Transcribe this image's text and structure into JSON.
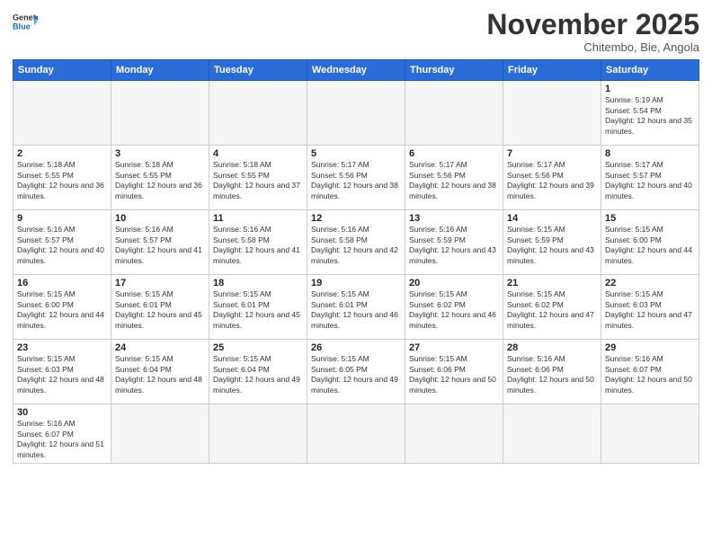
{
  "logo": {
    "text_general": "General",
    "text_blue": "Blue"
  },
  "header": {
    "month": "November 2025",
    "location": "Chitembo, Bie, Angola"
  },
  "days_of_week": [
    "Sunday",
    "Monday",
    "Tuesday",
    "Wednesday",
    "Thursday",
    "Friday",
    "Saturday"
  ],
  "weeks": [
    [
      {
        "num": "",
        "info": ""
      },
      {
        "num": "",
        "info": ""
      },
      {
        "num": "",
        "info": ""
      },
      {
        "num": "",
        "info": ""
      },
      {
        "num": "",
        "info": ""
      },
      {
        "num": "",
        "info": ""
      },
      {
        "num": "1",
        "info": "Sunrise: 5:19 AM\nSunset: 5:54 PM\nDaylight: 12 hours and 35 minutes."
      }
    ],
    [
      {
        "num": "2",
        "info": "Sunrise: 5:18 AM\nSunset: 5:55 PM\nDaylight: 12 hours and 36 minutes."
      },
      {
        "num": "3",
        "info": "Sunrise: 5:18 AM\nSunset: 5:55 PM\nDaylight: 12 hours and 36 minutes."
      },
      {
        "num": "4",
        "info": "Sunrise: 5:18 AM\nSunset: 5:55 PM\nDaylight: 12 hours and 37 minutes."
      },
      {
        "num": "5",
        "info": "Sunrise: 5:17 AM\nSunset: 5:56 PM\nDaylight: 12 hours and 38 minutes."
      },
      {
        "num": "6",
        "info": "Sunrise: 5:17 AM\nSunset: 5:56 PM\nDaylight: 12 hours and 38 minutes."
      },
      {
        "num": "7",
        "info": "Sunrise: 5:17 AM\nSunset: 5:56 PM\nDaylight: 12 hours and 39 minutes."
      },
      {
        "num": "8",
        "info": "Sunrise: 5:17 AM\nSunset: 5:57 PM\nDaylight: 12 hours and 40 minutes."
      }
    ],
    [
      {
        "num": "9",
        "info": "Sunrise: 5:16 AM\nSunset: 5:57 PM\nDaylight: 12 hours and 40 minutes."
      },
      {
        "num": "10",
        "info": "Sunrise: 5:16 AM\nSunset: 5:57 PM\nDaylight: 12 hours and 41 minutes."
      },
      {
        "num": "11",
        "info": "Sunrise: 5:16 AM\nSunset: 5:58 PM\nDaylight: 12 hours and 41 minutes."
      },
      {
        "num": "12",
        "info": "Sunrise: 5:16 AM\nSunset: 5:58 PM\nDaylight: 12 hours and 42 minutes."
      },
      {
        "num": "13",
        "info": "Sunrise: 5:16 AM\nSunset: 5:59 PM\nDaylight: 12 hours and 43 minutes."
      },
      {
        "num": "14",
        "info": "Sunrise: 5:15 AM\nSunset: 5:59 PM\nDaylight: 12 hours and 43 minutes."
      },
      {
        "num": "15",
        "info": "Sunrise: 5:15 AM\nSunset: 6:00 PM\nDaylight: 12 hours and 44 minutes."
      }
    ],
    [
      {
        "num": "16",
        "info": "Sunrise: 5:15 AM\nSunset: 6:00 PM\nDaylight: 12 hours and 44 minutes."
      },
      {
        "num": "17",
        "info": "Sunrise: 5:15 AM\nSunset: 6:01 PM\nDaylight: 12 hours and 45 minutes."
      },
      {
        "num": "18",
        "info": "Sunrise: 5:15 AM\nSunset: 6:01 PM\nDaylight: 12 hours and 45 minutes."
      },
      {
        "num": "19",
        "info": "Sunrise: 5:15 AM\nSunset: 6:01 PM\nDaylight: 12 hours and 46 minutes."
      },
      {
        "num": "20",
        "info": "Sunrise: 5:15 AM\nSunset: 6:02 PM\nDaylight: 12 hours and 46 minutes."
      },
      {
        "num": "21",
        "info": "Sunrise: 5:15 AM\nSunset: 6:02 PM\nDaylight: 12 hours and 47 minutes."
      },
      {
        "num": "22",
        "info": "Sunrise: 5:15 AM\nSunset: 6:03 PM\nDaylight: 12 hours and 47 minutes."
      }
    ],
    [
      {
        "num": "23",
        "info": "Sunrise: 5:15 AM\nSunset: 6:03 PM\nDaylight: 12 hours and 48 minutes."
      },
      {
        "num": "24",
        "info": "Sunrise: 5:15 AM\nSunset: 6:04 PM\nDaylight: 12 hours and 48 minutes."
      },
      {
        "num": "25",
        "info": "Sunrise: 5:15 AM\nSunset: 6:04 PM\nDaylight: 12 hours and 49 minutes."
      },
      {
        "num": "26",
        "info": "Sunrise: 5:15 AM\nSunset: 6:05 PM\nDaylight: 12 hours and 49 minutes."
      },
      {
        "num": "27",
        "info": "Sunrise: 5:15 AM\nSunset: 6:06 PM\nDaylight: 12 hours and 50 minutes."
      },
      {
        "num": "28",
        "info": "Sunrise: 5:16 AM\nSunset: 6:06 PM\nDaylight: 12 hours and 50 minutes."
      },
      {
        "num": "29",
        "info": "Sunrise: 5:16 AM\nSunset: 6:07 PM\nDaylight: 12 hours and 50 minutes."
      }
    ],
    [
      {
        "num": "30",
        "info": "Sunrise: 5:16 AM\nSunset: 6:07 PM\nDaylight: 12 hours and 51 minutes."
      },
      {
        "num": "",
        "info": ""
      },
      {
        "num": "",
        "info": ""
      },
      {
        "num": "",
        "info": ""
      },
      {
        "num": "",
        "info": ""
      },
      {
        "num": "",
        "info": ""
      },
      {
        "num": "",
        "info": ""
      }
    ]
  ]
}
